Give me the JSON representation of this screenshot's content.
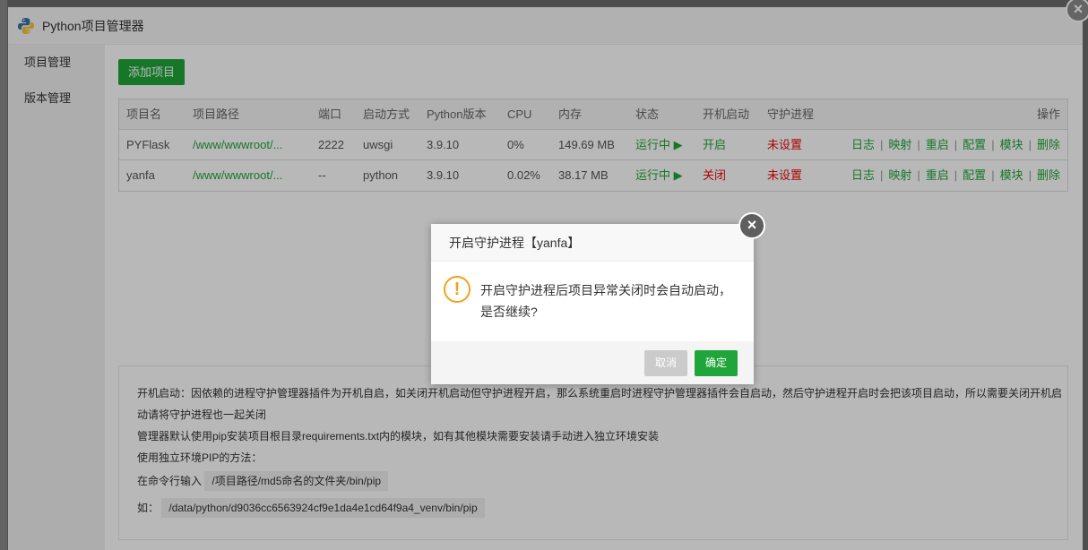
{
  "window": {
    "title": "Python项目管理器"
  },
  "sidebar": {
    "items": [
      {
        "label": "项目管理"
      },
      {
        "label": "版本管理"
      }
    ]
  },
  "toolbar": {
    "add_label": "添加项目"
  },
  "table": {
    "headers": [
      "项目名",
      "项目路径",
      "端口",
      "启动方式",
      "Python版本",
      "CPU",
      "内存",
      "状态",
      "开机启动",
      "守护进程",
      "操作"
    ],
    "rows": [
      {
        "name": "PYFlask",
        "path": "/www/wwwroot/...",
        "port": "2222",
        "method": "uwsgi",
        "version": "3.9.10",
        "cpu": "0%",
        "mem": "149.69 MB",
        "status": "运行中 ▶",
        "autostart": "开启",
        "daemon": "未设置"
      },
      {
        "name": "yanfa",
        "path": "/www/wwwroot/...",
        "port": "--",
        "method": "python",
        "version": "3.9.10",
        "cpu": "0.02%",
        "mem": "38.17 MB",
        "status": "运行中 ▶",
        "autostart": "关闭",
        "daemon": "未设置"
      }
    ],
    "actions": [
      "日志",
      "映射",
      "重启",
      "配置",
      "模块",
      "删除"
    ]
  },
  "notes": {
    "line1": "开机启动：因依赖的进程守护管理器插件为开机自启，如关闭开机启动但守护进程开启，那么系统重启时进程守护管理器插件会自启动，然后守护进程开启时会把该项目启动，所以需要关闭开机启",
    "line2": "动请将守护进程也一起关闭",
    "line3": "管理器默认使用pip安装项目根目录requirements.txt内的模块，如有其他模块需要安装请手动进入独立环境安装",
    "line4": "使用独立环境PIP的方法：",
    "line5_prefix": "在命令行输入",
    "line5_code": "/项目路径/md5命名的文件夹/bin/pip",
    "line6_prefix": "如：",
    "line6_code": "/data/python/d9036cc6563924cf9e1da4e1cd64f9a4_venv/bin/pip"
  },
  "dialog": {
    "title": "开启守护进程【yanfa】",
    "message_line1": "开启守护进程后项目异常关闭时会自动启动，",
    "message_line2": "是否继续?",
    "cancel_label": "取消",
    "ok_label": "确定"
  },
  "colors": {
    "accent": "#20a53a",
    "danger": "#ef0808",
    "warning": "#f0a21a"
  },
  "icons": {
    "app": "python-logo-icon",
    "close": "close-icon",
    "warning": "exclamation-icon"
  }
}
